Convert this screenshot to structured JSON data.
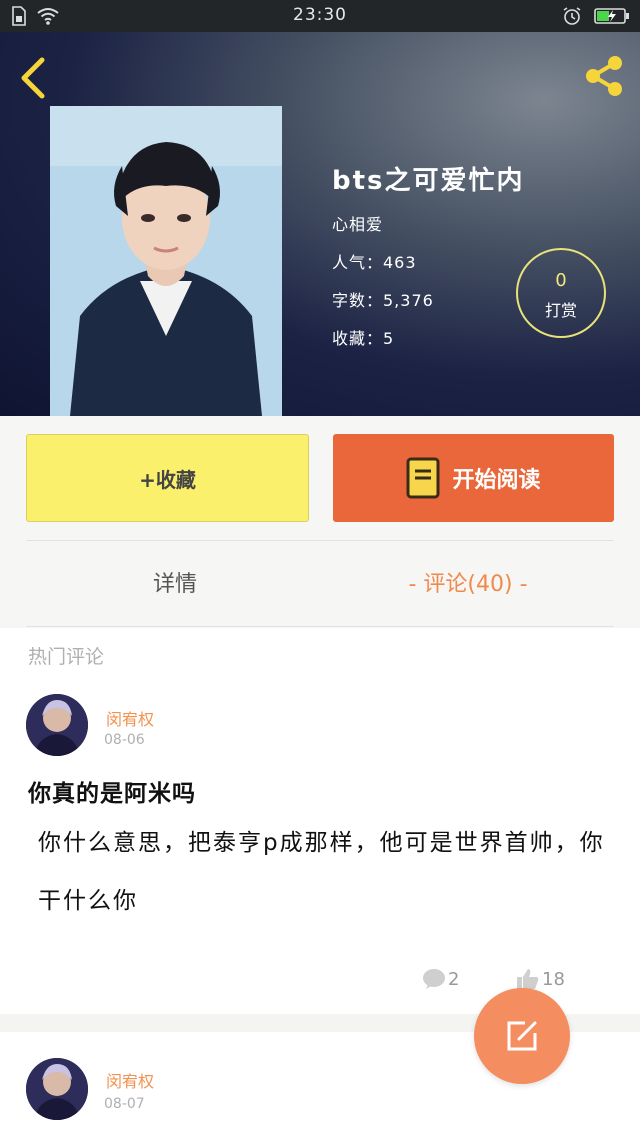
{
  "status_bar": {
    "time": "23:30"
  },
  "header": {
    "title": "bts之可爱忙内",
    "author": "心相爱",
    "popularity": "人气：463",
    "word_count": "字数：5,376",
    "favorites": "收藏：5",
    "tip": {
      "count": "0",
      "label": "打赏"
    }
  },
  "actions": {
    "collect_label": "+收藏",
    "read_label": "开始阅读"
  },
  "tabs": [
    {
      "label": "详情"
    },
    {
      "label": "- 评论(40) -"
    }
  ],
  "hot_comments_heading": "热门评论",
  "comments": [
    {
      "user": "闵宥权",
      "date": "08-06",
      "title": "你真的是阿米吗",
      "body": "你什么意思，把泰亨p成那样，他可是世界首帅，你干什么你",
      "replies": "2",
      "likes": "18"
    },
    {
      "user": "闵宥权",
      "date": "08-07"
    }
  ],
  "colors": {
    "accent_orange": "#e9673a",
    "collect_yellow": "#faf06c",
    "active_tab": "#f08a4b",
    "fab": "#f48d5f"
  }
}
